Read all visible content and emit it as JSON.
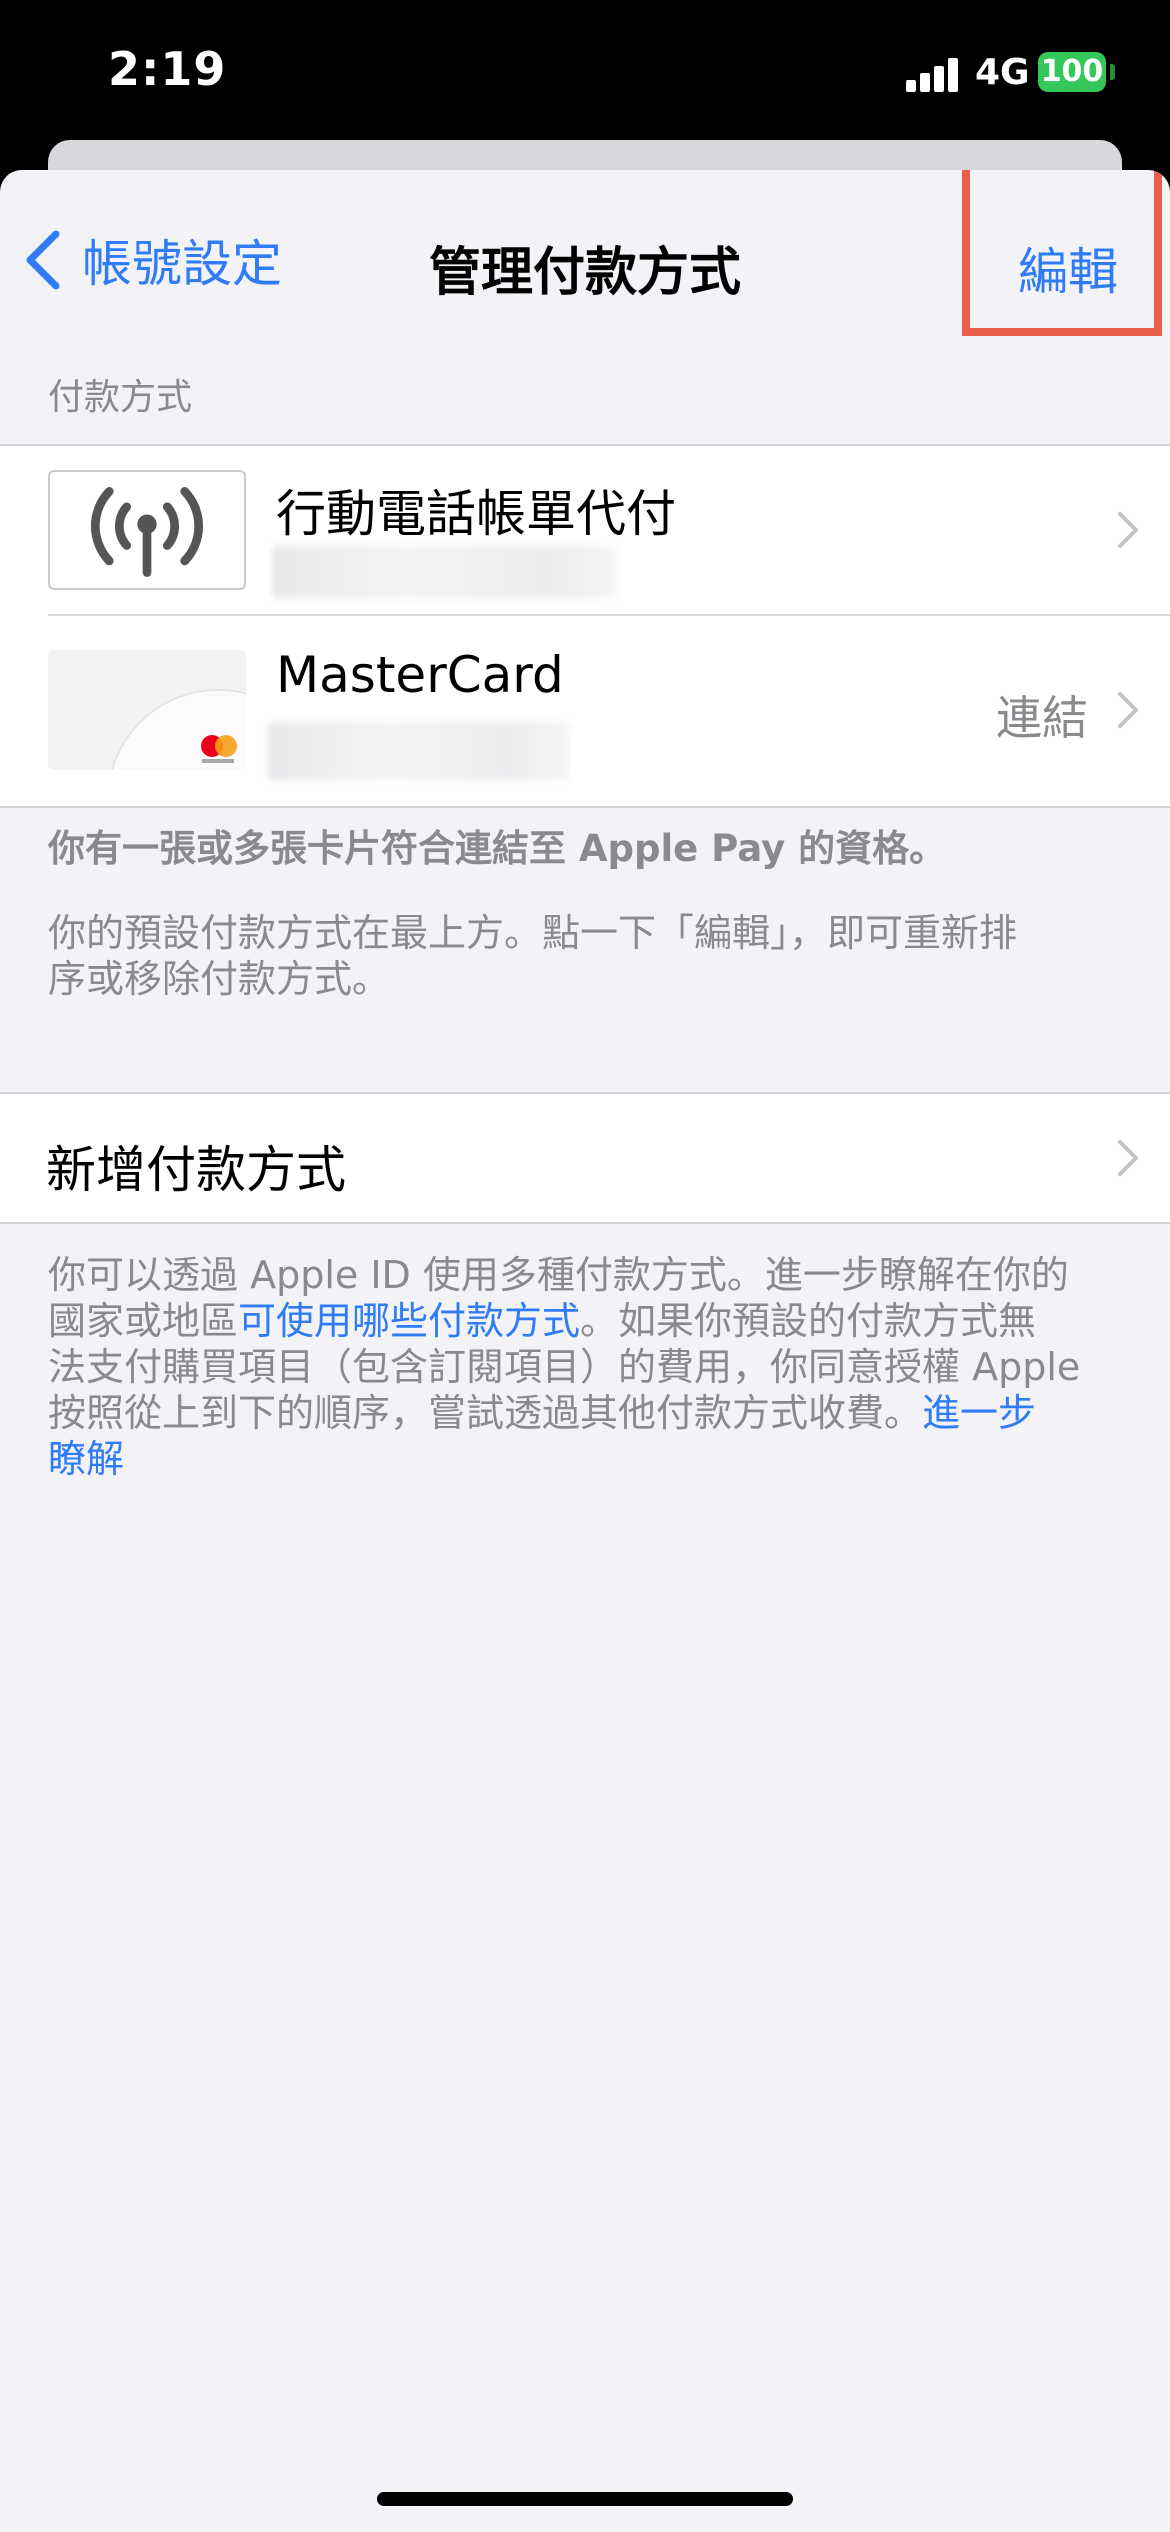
{
  "status_bar": {
    "time": "2:19",
    "network": "4G",
    "battery": "100"
  },
  "nav": {
    "back_label": "帳號設定",
    "title": "管理付款方式",
    "edit_label": "編輯"
  },
  "payment_section": {
    "header": "付款方式",
    "items": [
      {
        "title": "行動電話帳單代付",
        "icon": "cellular-antenna-icon"
      },
      {
        "title": "MasterCard",
        "detail": "連結",
        "icon": "mastercard-card-icon"
      }
    ],
    "footer_bold": "你有一張或多張卡片符合連結至 Apple Pay 的資格。",
    "footer_note_line1": "你的預設付款方式在最上方。點一下「編輯」，即可重新排",
    "footer_note_line2": "序或移除付款方式。"
  },
  "add_section": {
    "label": "新增付款方式",
    "info_line1": "你可以透過 Apple ID 使用多種付款方式。進一步瞭解在你的",
    "info_line2_pre": "國家或地區",
    "info_line2_link": "可使用哪些付款方式",
    "info_line2_post": "。如果你預設的付款方式無",
    "info_line3": "法支付購買項目（包含訂閱項目）的費用，你同意授權 Apple",
    "info_line4_pre": "按照從上到下的順序，嘗試透過其他付款方式收費。",
    "info_link_learn": "進一步",
    "info_link_learn_line2": "瞭解"
  },
  "colors": {
    "accent": "#2f7cf6",
    "highlight": "#e8604c",
    "background": "#f2f2f7"
  }
}
